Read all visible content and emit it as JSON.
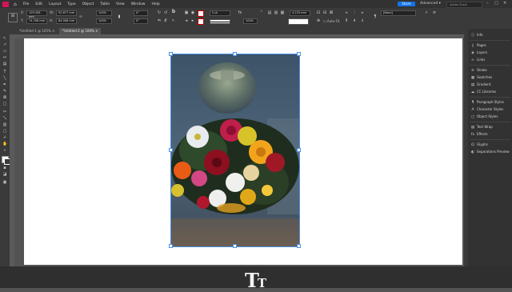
{
  "menu": {
    "home_icon": "home-icon",
    "items": [
      "File",
      "Edit",
      "Layout",
      "Type",
      "Object",
      "Table",
      "View",
      "Window",
      "Help"
    ],
    "share_label": "Share",
    "workspace": "Advanced",
    "search_placeholder": "Adobe Stock"
  },
  "control": {
    "x_value": "109.306 mm",
    "y_value": "74.708 mm",
    "w_value": "92.677 mm",
    "h_value": "84.008 mm",
    "scale_x": "100%",
    "scale_y": "100%",
    "rotate": "0°",
    "shear": "0°",
    "stroke_weight": "0 pt",
    "ref_value": "4.233 mm",
    "opacity": "100%",
    "style_select": "[None]",
    "autofit_label": "Auto-Fit"
  },
  "tabs": [
    "*Untitled-1 @ 105%",
    "*Untitled-2 @ 100%"
  ],
  "panels": [
    {
      "icon": "info-icon",
      "label": "Info"
    },
    {
      "icon": "pages-icon",
      "label": "Pages"
    },
    {
      "icon": "layers-icon",
      "label": "Layers"
    },
    {
      "icon": "links-icon",
      "label": "Links"
    },
    {
      "icon": "stroke-icon",
      "label": "Stroke"
    },
    {
      "icon": "swatches-icon",
      "label": "Swatches"
    },
    {
      "icon": "gradient-icon",
      "label": "Gradient"
    },
    {
      "icon": "cc-libraries-icon",
      "label": "CC Libraries"
    },
    {
      "icon": "paragraph-styles-icon",
      "label": "Paragraph Styles"
    },
    {
      "icon": "character-styles-icon",
      "label": "Character Styles"
    },
    {
      "icon": "object-styles-icon",
      "label": "Object Styles"
    },
    {
      "icon": "text-wrap-icon",
      "label": "Text Wrap"
    },
    {
      "icon": "effects-icon",
      "label": "Effects"
    },
    {
      "icon": "glyphs-icon",
      "label": "Glyphs"
    },
    {
      "icon": "separations-preview-icon",
      "label": "Separations Preview"
    }
  ],
  "overlay_logo": "Tт",
  "colors": {
    "accent": "#1473e6",
    "app_logo": "#d4145a",
    "selection": "#4a90e2"
  }
}
